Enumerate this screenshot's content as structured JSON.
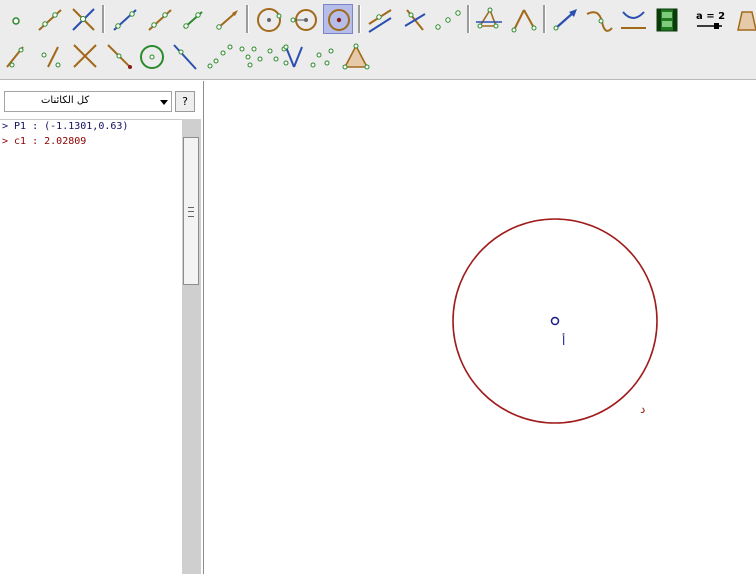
{
  "toolbar": {
    "row1": [
      "point-tool",
      "line-through-points-tool",
      "intersect-tool",
      "segment-tool",
      "ray-tool",
      "vector-tool",
      "polygon-tool",
      "circle-center-point-tool",
      "circle-three-points-tool",
      "compass-tool",
      "parallel-line-tool",
      "perpendicular-tool",
      "midpoint-tool",
      "angle-tool",
      "angle-size-tool",
      "vector-from-point-tool",
      "locus-tool",
      "semicircle-tool",
      "animation-tool",
      "slider-tool",
      "polygon-shape-tool"
    ],
    "slider_label": "a = 2",
    "row2": [
      "slope-tool",
      "relation-tool",
      "reflect-line-tool",
      "reflect-point-tool",
      "dilate-tool",
      "tangent-tool",
      "locus-points-tool",
      "translate-tool",
      "rotate-tool",
      "triangle-tool",
      "sequence-tool",
      "triangle-center-tool"
    ]
  },
  "sidebar": {
    "filter_value": "كل الكائنات",
    "help_label": "?",
    "objects": [
      {
        "text": "> P1 : (-1.1301,0.63)",
        "color": "#101060"
      },
      {
        "text": "> c1 : 2.02809",
        "color": "#8b0000"
      }
    ]
  },
  "canvas": {
    "center_label": "أ",
    "circle_label": "د",
    "circle_color": "#a01c1c",
    "point_color": "#1a1a8c"
  }
}
